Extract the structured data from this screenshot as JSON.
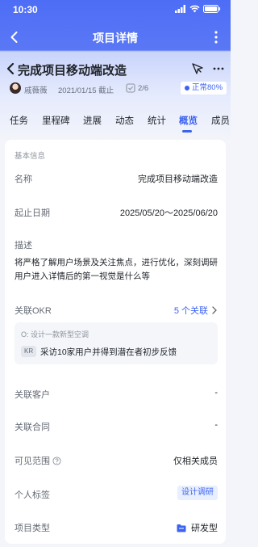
{
  "status_bar": {
    "time": "10:30"
  },
  "nav": {
    "title": "项目详情"
  },
  "project": {
    "title": "完成项目移动端改造",
    "owner": "戚薇薇",
    "deadline": "2021/01/15 截止",
    "progress": "2/6",
    "status": "正常80%"
  },
  "tabs": [
    {
      "label": "任务"
    },
    {
      "label": "里程碑"
    },
    {
      "label": "进展"
    },
    {
      "label": "动态"
    },
    {
      "label": "统计"
    },
    {
      "label": "概览"
    },
    {
      "label": "成员"
    }
  ],
  "active_tab": "概览",
  "info": {
    "section_title": "基本信息",
    "name_label": "名称",
    "name_value": "完成项目移动端改造",
    "date_label": "起止日期",
    "date_value": "2025/05/20～2025/06/20",
    "desc_label": "描述",
    "desc_value": "将严格了解用户场景及关注焦点，进行优化，深刻调研用户进入详情后的第一视觉是什么等",
    "okr_label": "关联OKR",
    "okr_link": "5 个关联",
    "okr_objective": "O: 设计一款新型空调",
    "kr_tag": "KR",
    "kr_text": "采访10家用户并得到潜在者初步反馈",
    "customer_label": "关联客户",
    "customer_value": "-",
    "contract_label": "关联合同",
    "contract_value": "-",
    "visibility_label": "可见范围",
    "visibility_value": "仅相关成员",
    "tag_label": "个人标签",
    "tag_value": "设计调研",
    "type_label": "项目类型",
    "type_value": "研发型"
  },
  "colors": {
    "accent": "#3c63f0",
    "header": "#4d6df6"
  }
}
